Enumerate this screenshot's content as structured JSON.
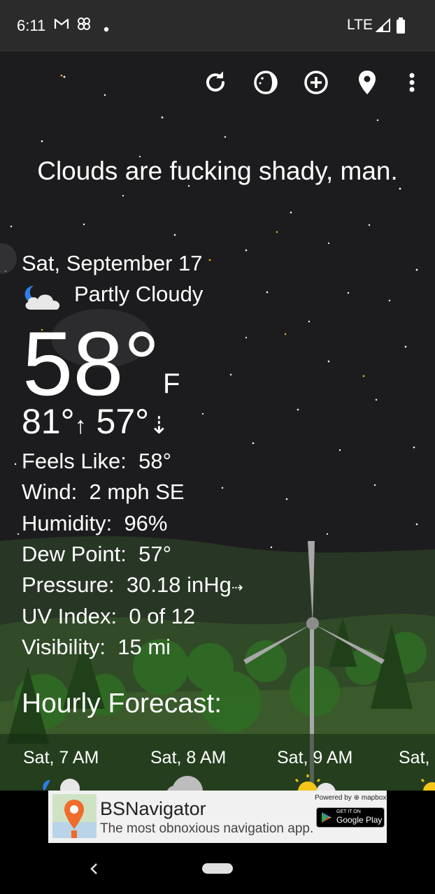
{
  "status_bar": {
    "time": "6:11",
    "network": "LTE",
    "icons": [
      "gmail-icon",
      "pinwheel-icon",
      "dot-icon",
      "signal-icon",
      "battery-icon"
    ]
  },
  "toolbar": {
    "icons": [
      "refresh-icon",
      "theme-icon",
      "add-location-icon",
      "location-pin-icon",
      "more-vert-icon"
    ]
  },
  "quote": "Clouds are fucking shady, man.",
  "current": {
    "date": "Sat, September 17",
    "condition": "Partly Cloudy",
    "condition_icon": "partly-cloudy-night-icon",
    "temperature": "58°",
    "unit": "F",
    "high": "81°",
    "low": "57°",
    "high_arrow": "↑",
    "low_arrow": "⇣"
  },
  "details": [
    {
      "label": "Feels Like:",
      "value": "58°"
    },
    {
      "label": "Wind:",
      "value": "2 mph SE"
    },
    {
      "label": "Humidity:",
      "value": "96%"
    },
    {
      "label": "Dew Point:",
      "value": "57°"
    },
    {
      "label": "Pressure:",
      "value": "30.18 inHg",
      "trend": "⇢"
    },
    {
      "label": "UV Index:",
      "value": "0 of 12"
    },
    {
      "label": "Visibility:",
      "value": "15 mi"
    }
  ],
  "hourly": {
    "title": "Hourly Forecast:",
    "items": [
      {
        "time": "Sat, 7 AM",
        "icon": "partly-cloudy-night-icon"
      },
      {
        "time": "Sat, 8 AM",
        "icon": "cloudy-icon"
      },
      {
        "time": "Sat, 9 AM",
        "icon": "partly-sunny-icon"
      },
      {
        "time": "Sat,",
        "icon": "sunny-icon"
      }
    ]
  },
  "ad": {
    "title": "BSNavigator",
    "subtitle": "The most obnoxious navigation app.",
    "powered_by": "Powered by ⊕ mapbox",
    "store_small": "GET IT ON",
    "store_name": "Google Play"
  },
  "colors": {
    "status_bar": "#2b2b2b",
    "sky": "#1c1c1e",
    "grass": "#2f4a26",
    "sun": "#f5c518"
  }
}
